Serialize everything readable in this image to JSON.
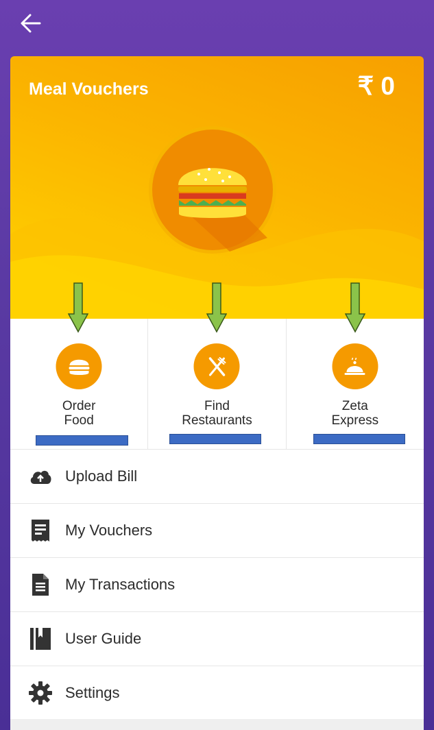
{
  "header": {
    "back_icon": "back-arrow-icon"
  },
  "card": {
    "title": "Meal Vouchers",
    "currency": "₹",
    "balance": "0",
    "illustration": "burger-icon",
    "colors": {
      "top": "#f7a000",
      "bottom": "#ffd400",
      "circle": "#f59a00"
    }
  },
  "actions": [
    {
      "label": "Order\nFood",
      "icon": "burger-icon"
    },
    {
      "label": "Find\nRestaurants",
      "icon": "fork-knife-icon"
    },
    {
      "label": "Zeta\nExpress",
      "icon": "cloche-icon"
    }
  ],
  "menu": [
    {
      "label": "Upload Bill",
      "icon": "cloud-upload-icon"
    },
    {
      "label": "My Vouchers",
      "icon": "receipt-icon"
    },
    {
      "label": "My Transactions",
      "icon": "document-icon"
    },
    {
      "label": "User Guide",
      "icon": "book-icon"
    },
    {
      "label": "Settings",
      "icon": "gear-icon"
    }
  ],
  "annotations": {
    "arrow_color": "#8bc34a",
    "bar_color": "#3c6bc4"
  }
}
